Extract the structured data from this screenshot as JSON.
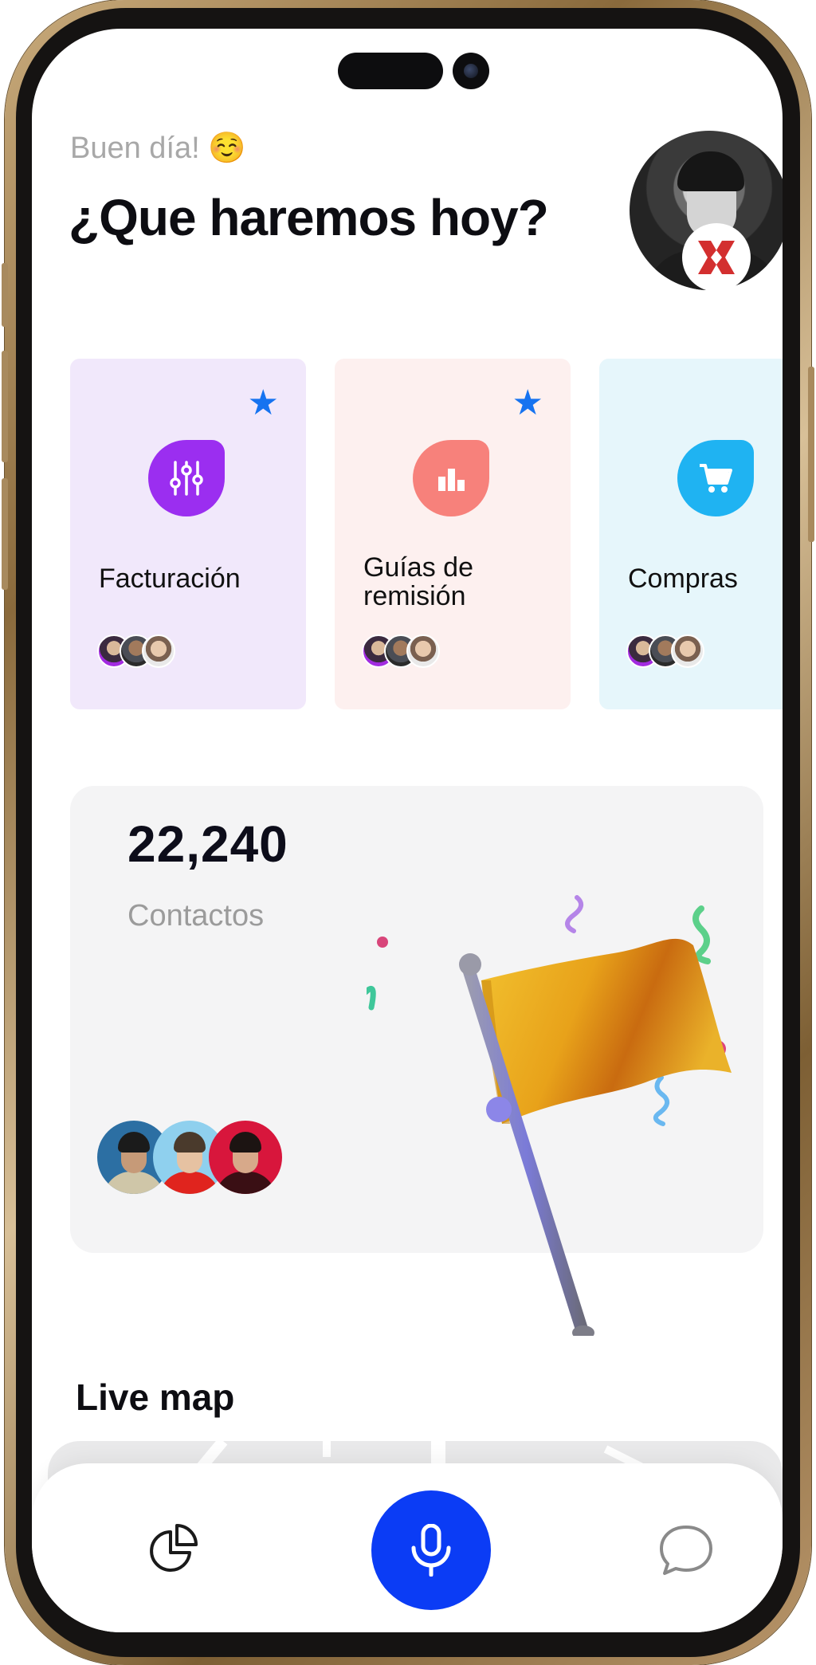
{
  "header": {
    "greeting": "Buen día! ☺️",
    "headline": "¿Que haremos hoy?"
  },
  "profile": {
    "avatar_icon": "user-avatar",
    "badge_icon": "company-logo",
    "badge_color": "#d32f2f"
  },
  "modules": [
    {
      "label": "Facturación",
      "icon": "sliders-icon",
      "bg": "#f1e8fb",
      "icon_color": "#9b2ef0",
      "favorite": true
    },
    {
      "label": "Guías de remisión",
      "icon": "bar-chart-icon",
      "bg": "#fdf0ef",
      "icon_color": "#f7817b",
      "favorite": true
    },
    {
      "label": "Compras",
      "icon": "cart-icon",
      "bg": "#e6f6fb",
      "icon_color": "#1fb3f2",
      "favorite": true
    }
  ],
  "contacts": {
    "count": "22,240",
    "label": "Contactos",
    "illustration": "flag-illustration"
  },
  "live_map": {
    "title": "Live map"
  },
  "tabbar": {
    "stats_icon": "pie-chart-icon",
    "mic_icon": "microphone-icon",
    "chat_icon": "chat-bubble-icon",
    "accent": "#0b3cf5"
  }
}
